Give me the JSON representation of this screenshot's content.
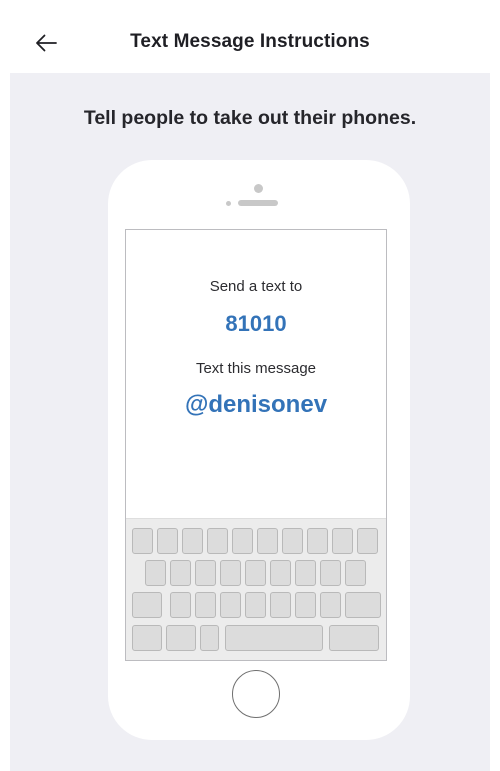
{
  "status_bar": {
    "signal_icon": "signal-mark"
  },
  "header": {
    "back_icon": "arrow-left-icon",
    "title": "Text Message Instructions"
  },
  "main": {
    "tagline": "Tell people to take out their phones.",
    "phone_screen": {
      "send_label": "Send a text to",
      "number": "81010",
      "message_label": "Text this message",
      "keyword": "@denisonev"
    }
  },
  "colors": {
    "accent": "#3373b8",
    "background": "#efeff4",
    "phone_body": "#ffffff"
  }
}
